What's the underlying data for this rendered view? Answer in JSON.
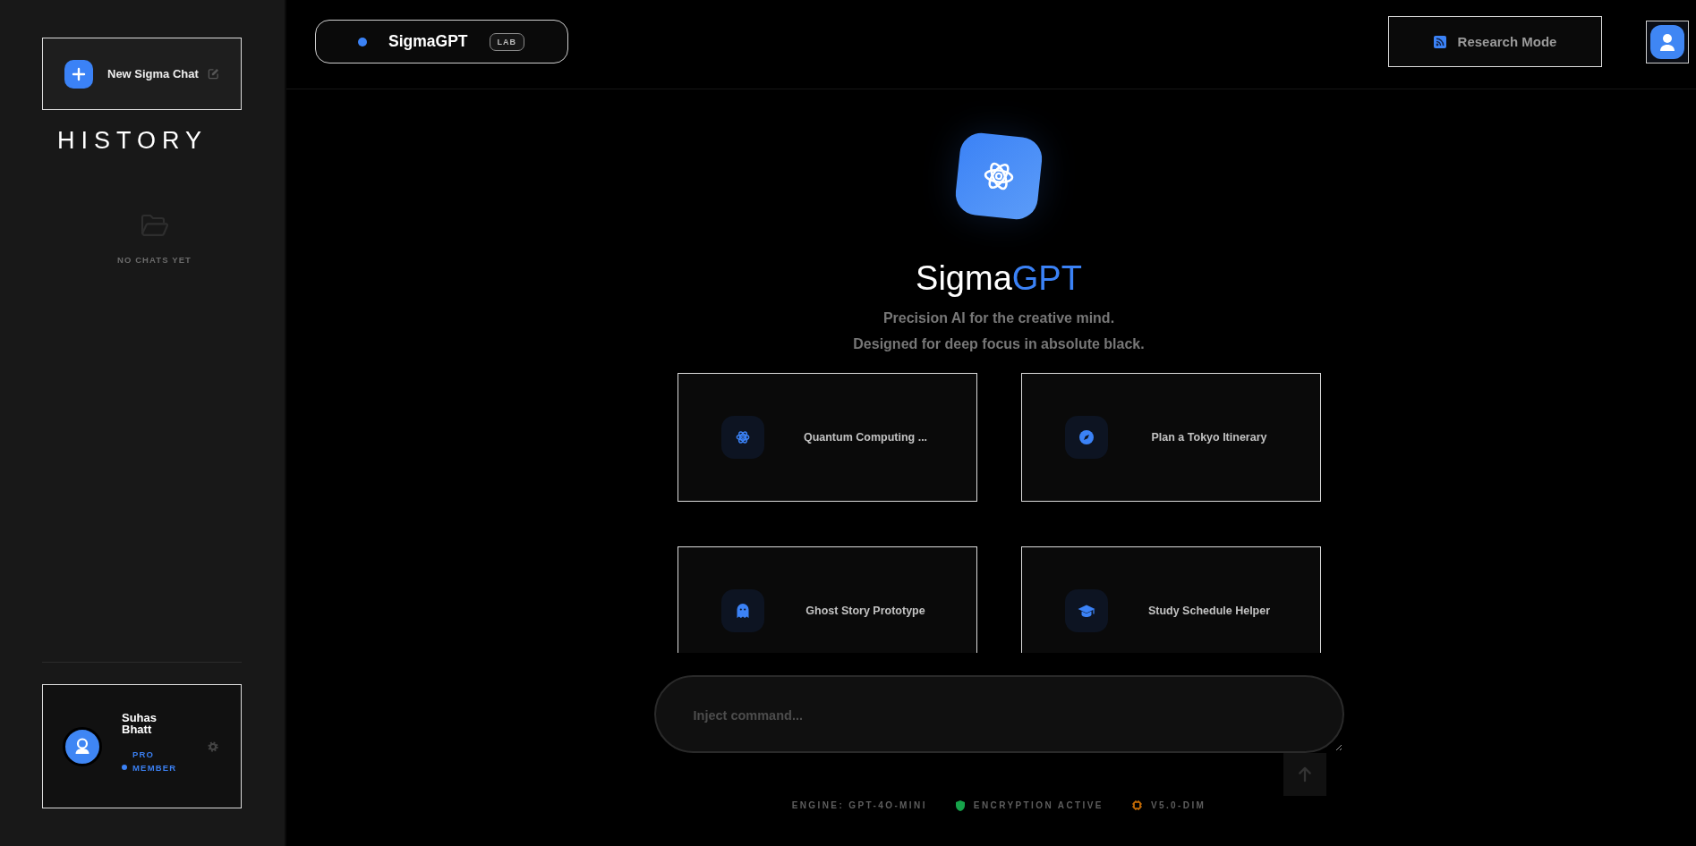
{
  "sidebar": {
    "new_chat": {
      "label": "New Sigma Chat"
    },
    "history_title": "HISTORY",
    "empty_state": "NO CHATS YET",
    "profile": {
      "name": "Suhas Bhatt",
      "badge": "PRO MEMBER"
    }
  },
  "header": {
    "brand": {
      "name": "SigmaGPT",
      "badge": "LAB"
    },
    "research_button": {
      "label": "Research Mode"
    }
  },
  "hero": {
    "title": {
      "text": "Sigma",
      "accent": "GPT"
    },
    "tagline": [
      "Precision AI for the creative mind.",
      "Designed for deep focus in absolute black."
    ]
  },
  "suggestions": [
    {
      "kind": "atom",
      "label": "Quantum Computing ..."
    },
    {
      "kind": "compass",
      "label": "Plan a Tokyo Itinerary"
    },
    {
      "kind": "ghost",
      "label": "Ghost Story Prototype"
    },
    {
      "kind": "graduation-cap",
      "label": "Study Schedule Helper"
    }
  ],
  "composer": {
    "placeholder": "Inject command..."
  },
  "status_bar": [
    {
      "kind": "text",
      "label": "ENGINE: GPT-4O-MINI"
    },
    {
      "kind": "shield",
      "label": "ENCRYPTION ACTIVE"
    },
    {
      "kind": "chip",
      "label": "V5.0-DIM"
    }
  ]
}
